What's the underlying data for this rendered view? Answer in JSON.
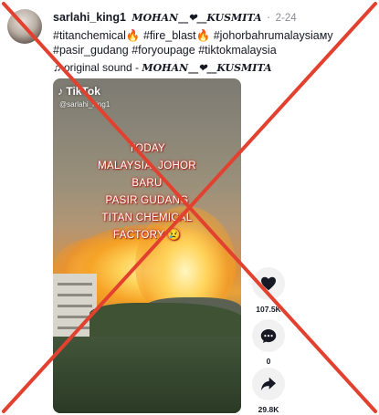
{
  "post": {
    "username": "sarlahi_king1",
    "nickname": "MOHAN__❤__KUSMITA",
    "separator": "·",
    "date": "2-24",
    "caption_tags": [
      "#titanchemical🔥",
      "#fire_blast🔥",
      "#johorbahrumalaysiaмy",
      "#pasir_gudang",
      "#foryoupage",
      "#tiktokmalaysia"
    ],
    "music_icon": "♫",
    "music_label": "original sound - ",
    "music_artist": "MOHAN__❤__KUSMITA"
  },
  "video": {
    "logo_text": "♪ TikTok",
    "handle": "@sarlahi_king1",
    "overlay_lines": [
      "TODAY",
      "MALAYSIA, JOHOR",
      "BARU",
      "PASIR GUDANG",
      "TITAN CHEMICAL",
      "FACTORY 😢"
    ]
  },
  "actions": {
    "likes": "107.5K",
    "comments": "0",
    "shares": "29.8K"
  },
  "colors": {
    "cross": "#e2412f",
    "overlay_glow": "#c0392b",
    "action_bg": "#f1f1f2"
  },
  "icons": [
    "avatar",
    "music-note-icon",
    "tiktok-logo-icon",
    "heart-icon",
    "comment-icon",
    "share-icon",
    "red-x-mark"
  ]
}
